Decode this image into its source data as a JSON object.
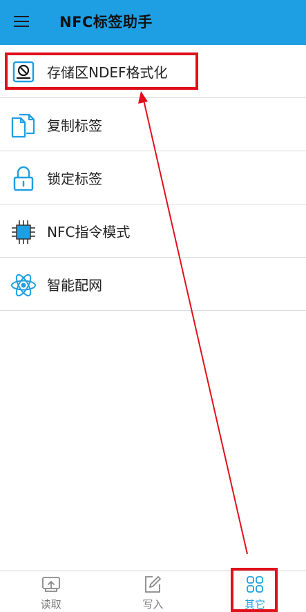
{
  "header": {
    "title": "NFC标签助手",
    "menu_icon": "hamburger-menu-icon",
    "background": "#1E9FE4"
  },
  "menu": {
    "items": [
      {
        "label": "存储区NDEF格式化",
        "icon": "storage-format-icon"
      },
      {
        "label": "复制标签",
        "icon": "copy-icon"
      },
      {
        "label": "锁定标签",
        "icon": "lock-icon"
      },
      {
        "label": "NFC指令模式",
        "icon": "chip-icon"
      },
      {
        "label": "智能配网",
        "icon": "atom-icon"
      }
    ]
  },
  "bottom_nav": {
    "items": [
      {
        "label": "读取",
        "icon": "read-tray-icon"
      },
      {
        "label": "写入",
        "icon": "edit-icon"
      },
      {
        "label": "其它",
        "icon": "grid-apps-icon",
        "active": true
      }
    ],
    "active_color": "#1E9FE4"
  },
  "annotations": {
    "highlight_color": "#e0101a",
    "arrow": "from-active-tab-to-first-menu-item"
  }
}
